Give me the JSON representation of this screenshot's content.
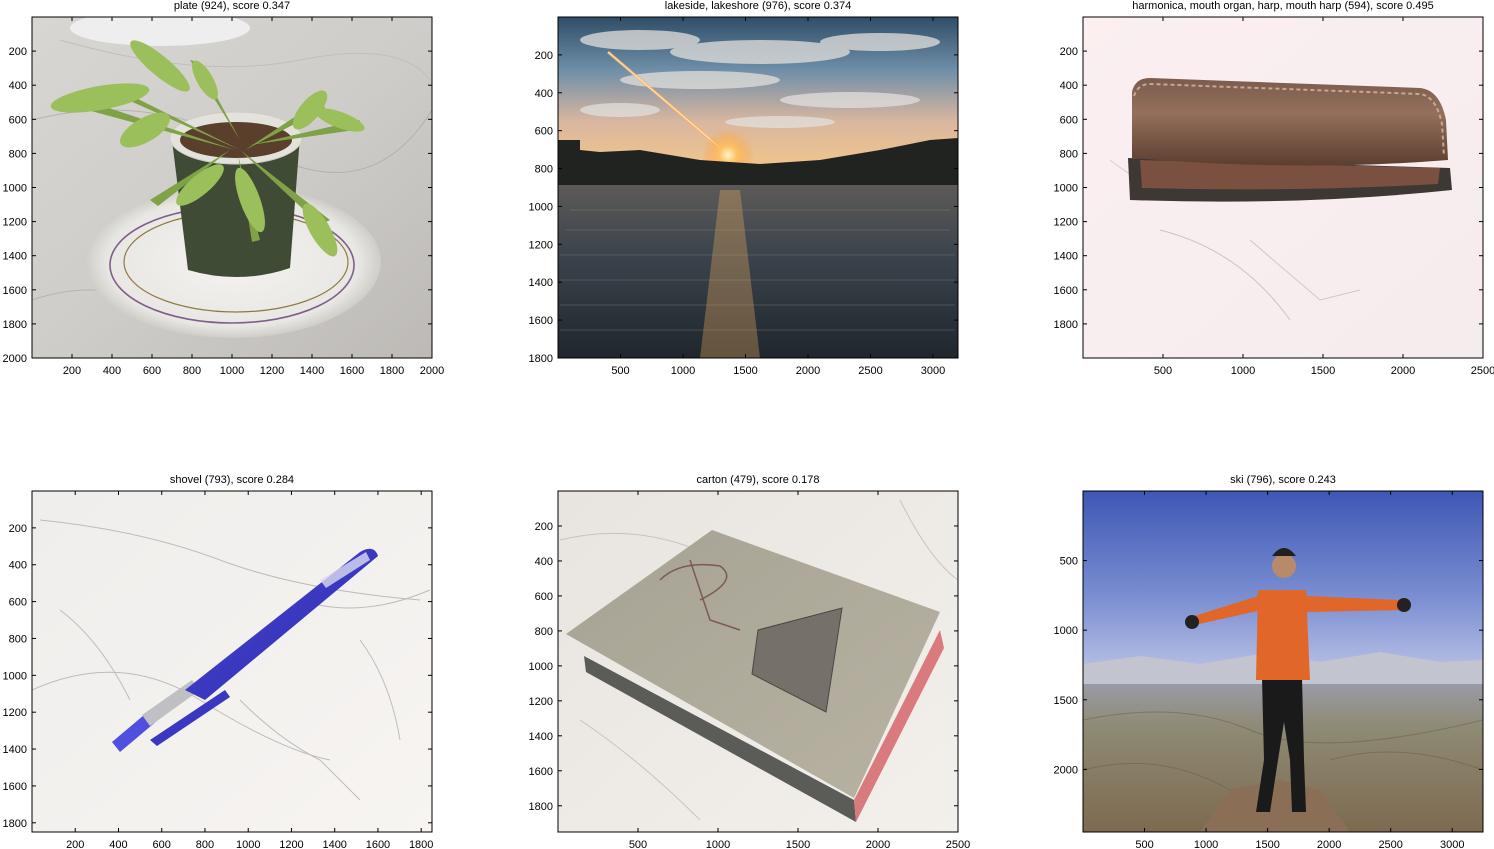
{
  "chart_data": [
    {
      "type": "image",
      "title": "plate (924), score 0.347",
      "image": "potted-plant-on-plate",
      "xlim": [
        0,
        2000
      ],
      "ylim": [
        0,
        2000
      ],
      "xticks": [
        200,
        400,
        600,
        800,
        1000,
        1200,
        1400,
        1600,
        1800,
        2000
      ],
      "yticks": [
        200,
        400,
        600,
        800,
        1000,
        1200,
        1400,
        1600,
        1800,
        2000
      ]
    },
    {
      "type": "image",
      "title": "lakeside, lakeshore (976), score 0.374",
      "image": "sunset-over-lake",
      "xlim": [
        0,
        3200
      ],
      "ylim": [
        0,
        1800
      ],
      "xticks": [
        500,
        1000,
        1500,
        2000,
        2500,
        3000
      ],
      "yticks": [
        200,
        400,
        600,
        800,
        1000,
        1200,
        1400,
        1600,
        1800
      ]
    },
    {
      "type": "image",
      "title": "harmonica, mouth organ, harp, mouth harp (594), score 0.495",
      "image": "leather-pen-case",
      "xlim": [
        0,
        2500
      ],
      "ylim": [
        0,
        2000
      ],
      "xticks": [
        500,
        1000,
        1500,
        2000,
        2500
      ],
      "yticks": [
        200,
        400,
        600,
        800,
        1000,
        1200,
        1400,
        1600,
        1800
      ]
    },
    {
      "type": "image",
      "title": "shovel (793), score 0.284",
      "image": "blue-pen-on-marble",
      "xlim": [
        0,
        1850
      ],
      "ylim": [
        0,
        1850
      ],
      "xticks": [
        200,
        400,
        600,
        800,
        1000,
        1200,
        1400,
        1600,
        1800
      ],
      "yticks": [
        200,
        400,
        600,
        800,
        1000,
        1200,
        1400,
        1600,
        1800
      ]
    },
    {
      "type": "image",
      "title": "carton (479), score 0.178",
      "image": "book-on-marble",
      "xlim": [
        0,
        2500
      ],
      "ylim": [
        0,
        1950
      ],
      "xticks": [
        500,
        1000,
        1500,
        2000,
        2500
      ],
      "yticks": [
        200,
        400,
        600,
        800,
        1000,
        1200,
        1400,
        1600,
        1800
      ]
    },
    {
      "type": "image",
      "title": "ski (796), score 0.243",
      "image": "hiker-on-mountain-summit",
      "xlim": [
        0,
        3250
      ],
      "ylim": [
        0,
        2450
      ],
      "xticks": [
        500,
        1000,
        1500,
        2000,
        2500,
        3000
      ],
      "yticks": [
        500,
        1000,
        1500,
        2000
      ]
    }
  ]
}
